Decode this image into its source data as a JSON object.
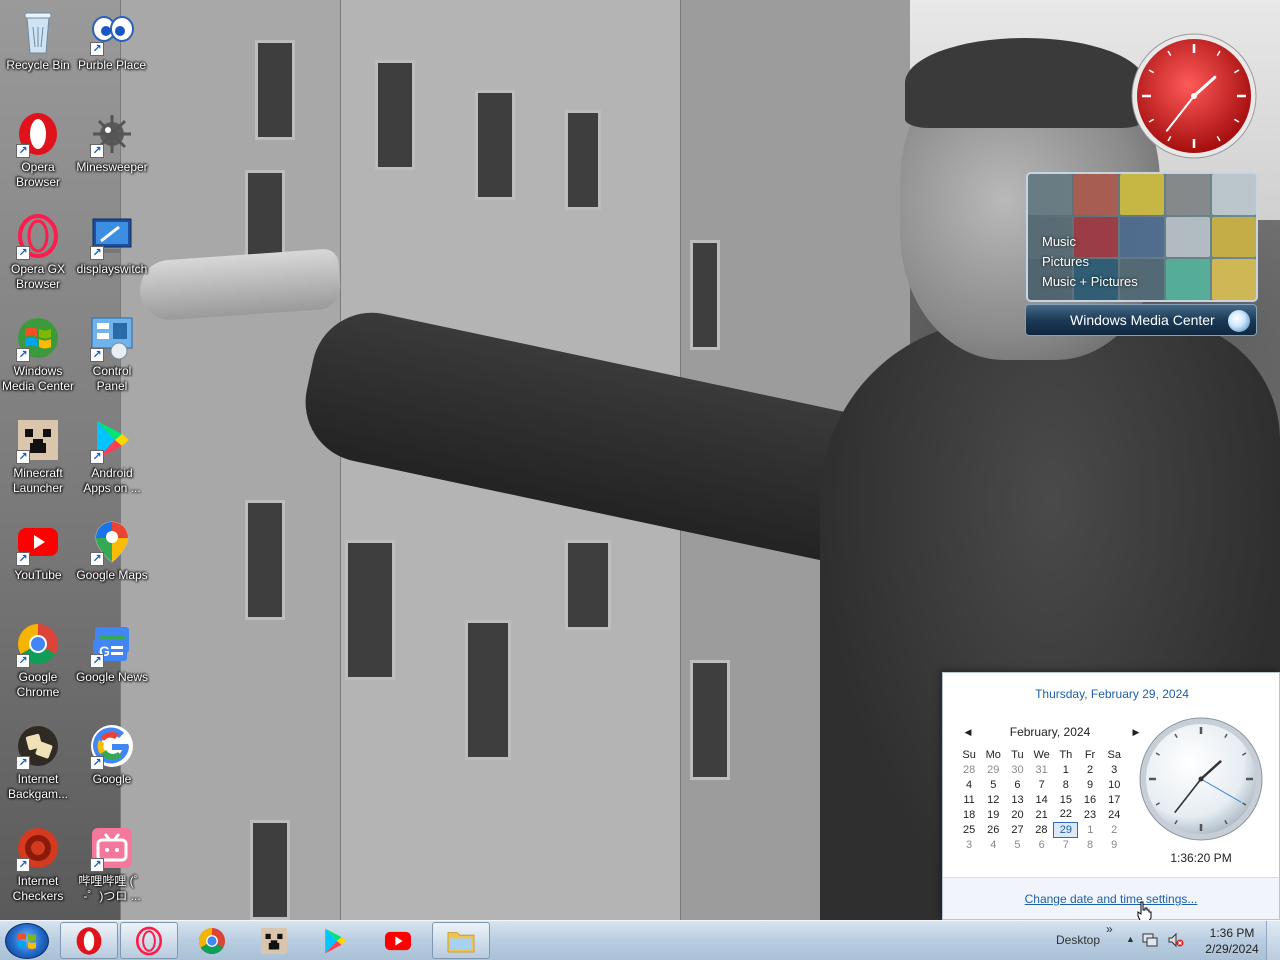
{
  "desktop": {
    "icons": [
      {
        "label": "Recycle Bin",
        "icon": "recycle-bin-icon",
        "shortcut": false
      },
      {
        "label": "Purble Place",
        "icon": "purble-place-icon",
        "shortcut": true
      },
      {
        "label": "Opera\nBrowser",
        "icon": "opera-icon",
        "shortcut": true
      },
      {
        "label": "Minesweeper",
        "icon": "minesweeper-icon",
        "shortcut": true
      },
      {
        "label": "Opera GX\nBrowser",
        "icon": "opera-gx-icon",
        "shortcut": true
      },
      {
        "label": "displayswitch",
        "icon": "displayswitch-icon",
        "shortcut": true
      },
      {
        "label": "Windows\nMedia Center",
        "icon": "windows-media-center-icon",
        "shortcut": true
      },
      {
        "label": "Control\nPanel",
        "icon": "control-panel-icon",
        "shortcut": true
      },
      {
        "label": "Minecraft\nLauncher",
        "icon": "minecraft-icon",
        "shortcut": true
      },
      {
        "label": "Android\nApps on ...",
        "icon": "google-play-icon",
        "shortcut": true
      },
      {
        "label": "YouTube",
        "icon": "youtube-icon",
        "shortcut": true
      },
      {
        "label": "Google Maps",
        "icon": "google-maps-icon",
        "shortcut": true
      },
      {
        "label": "Google\nChrome",
        "icon": "chrome-icon",
        "shortcut": true
      },
      {
        "label": "Google News",
        "icon": "google-news-icon",
        "shortcut": true
      },
      {
        "label": "Internet\nBackgam...",
        "icon": "internet-backgammon-icon",
        "shortcut": true
      },
      {
        "label": "Google",
        "icon": "google-icon",
        "shortcut": true
      },
      {
        "label": "Internet\nCheckers",
        "icon": "internet-checkers-icon",
        "shortcut": true
      },
      {
        "label": "哔哩哔哩 (゜\n-゜)つロ ...",
        "icon": "bilibili-icon",
        "shortcut": true
      }
    ]
  },
  "gadgets": {
    "clock": {
      "hour": 1,
      "minute": 36,
      "second": 20,
      "color": "#d21f1f"
    },
    "media_center": {
      "menu": [
        "Music",
        "Pictures",
        "Music + Pictures"
      ],
      "bar_label": "Windows Media Center"
    }
  },
  "calendar_popup": {
    "full_date": "Thursday, February 29, 2024",
    "month_title": "February, 2024",
    "prev_glyph": "◀",
    "next_glyph": "▶",
    "weekdays": [
      "Su",
      "Mo",
      "Tu",
      "We",
      "Th",
      "Fr",
      "Sa"
    ],
    "weeks": [
      [
        "28",
        "29",
        "30",
        "31",
        "1",
        "2",
        "3"
      ],
      [
        "4",
        "5",
        "6",
        "7",
        "8",
        "9",
        "10"
      ],
      [
        "11",
        "12",
        "13",
        "14",
        "15",
        "16",
        "17"
      ],
      [
        "18",
        "19",
        "20",
        "21",
        "22",
        "23",
        "24"
      ],
      [
        "25",
        "26",
        "27",
        "28",
        "29",
        "1",
        "2"
      ],
      [
        "3",
        "4",
        "5",
        "6",
        "7",
        "8",
        "9"
      ]
    ],
    "today": "29",
    "time": "1:36:20 PM",
    "settings_link": "Change date and time settings..."
  },
  "taskbar": {
    "pinned": [
      {
        "name": "opera",
        "icon": "opera-icon"
      },
      {
        "name": "opera-gx",
        "icon": "opera-gx-icon"
      },
      {
        "name": "chrome",
        "icon": "chrome-icon"
      },
      {
        "name": "minecraft",
        "icon": "minecraft-icon"
      },
      {
        "name": "google-play",
        "icon": "google-play-icon"
      },
      {
        "name": "youtube",
        "icon": "youtube-icon"
      },
      {
        "name": "file-explorer",
        "icon": "folder-icon"
      }
    ],
    "tray": {
      "desktop_label": "Desktop",
      "chevron": "»",
      "up_arrow": "▲",
      "time": "1:36 PM",
      "date": "2/29/2024"
    }
  },
  "colors": {
    "accent_link": "#1e5fa9",
    "taskbar": "#b9cde0"
  }
}
